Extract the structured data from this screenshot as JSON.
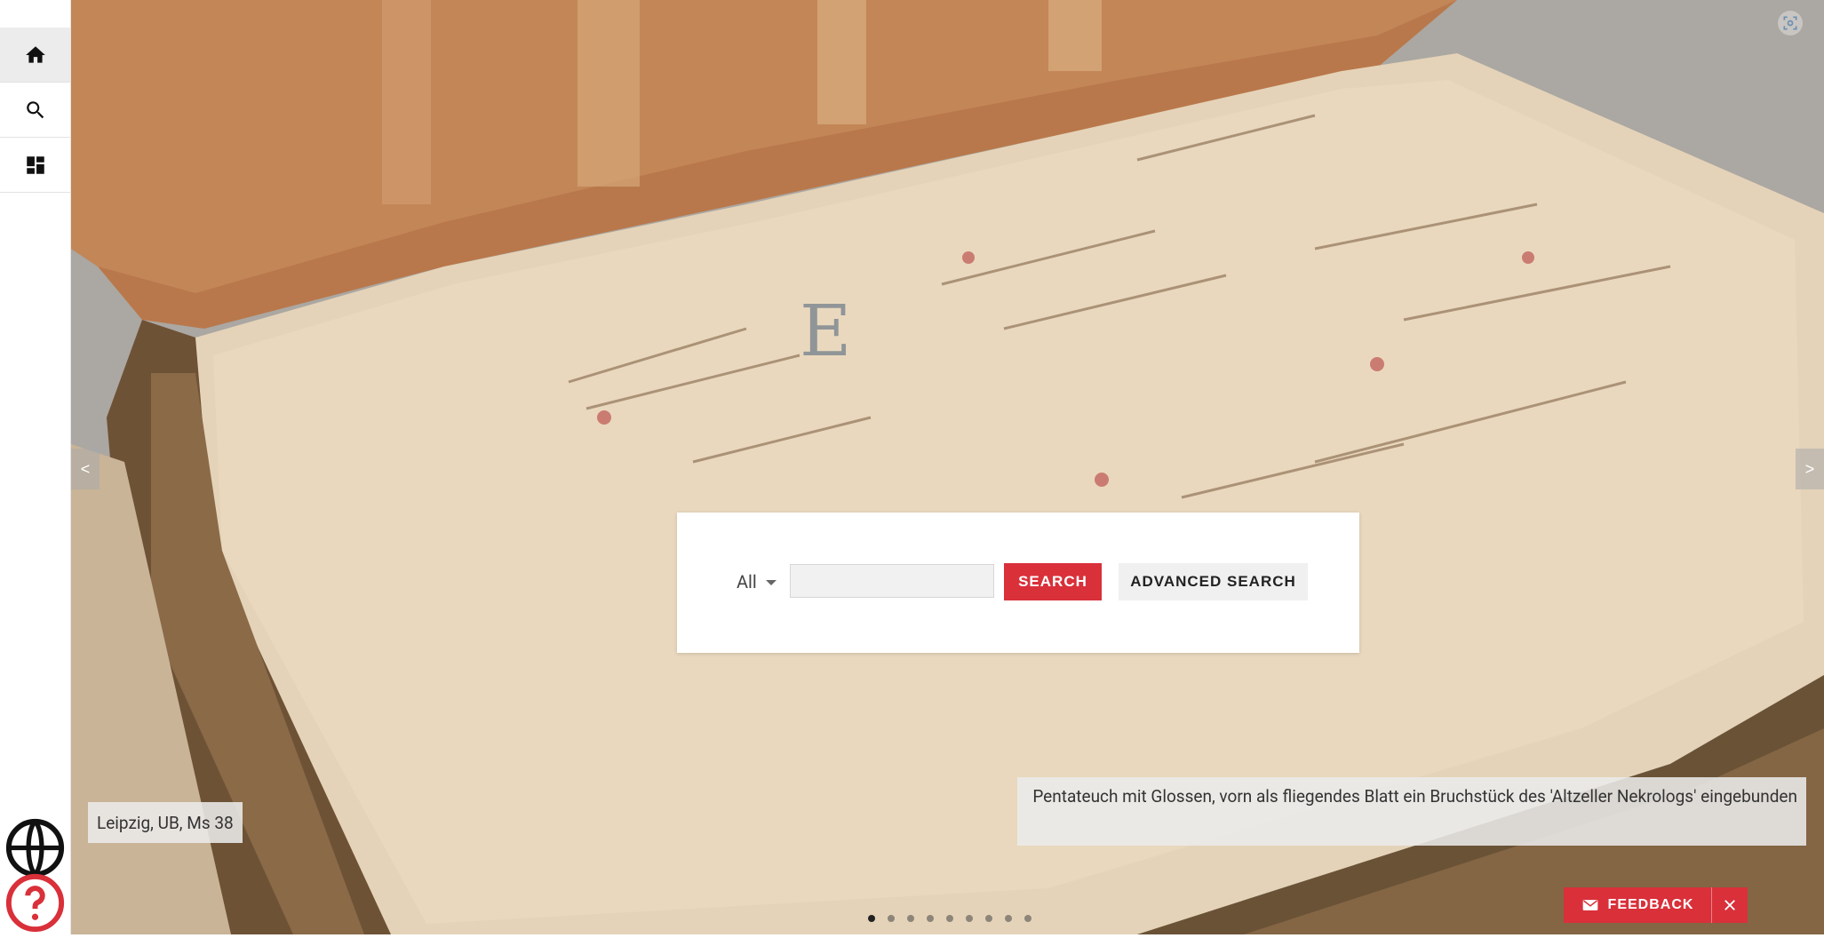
{
  "sidebar": {
    "items": [
      {
        "icon": "home-icon",
        "active": true
      },
      {
        "icon": "search-icon",
        "active": false
      },
      {
        "icon": "dashboard-icon",
        "active": false
      }
    ],
    "bottom": [
      {
        "icon": "globe-icon"
      },
      {
        "icon": "help-icon"
      }
    ]
  },
  "hero": {
    "prev_label": "<",
    "next_label": ">",
    "caption_left": "Leipzig, UB, Ms 38",
    "caption_right": "Pentateuch mit Glossen, vorn als fliegendes Blatt ein Bruchstück des 'Altzeller Nekrologs' eingebunden",
    "dots_total": 9,
    "dot_active": 1
  },
  "search": {
    "scope": "All",
    "placeholder": "",
    "value": "",
    "search_label": "SEARCH",
    "advanced_label": "ADVANCED SEARCH"
  },
  "feedback": {
    "label": "FEEDBACK"
  },
  "colors": {
    "accent": "#d9303a",
    "sidebar_active": "#ececec"
  }
}
